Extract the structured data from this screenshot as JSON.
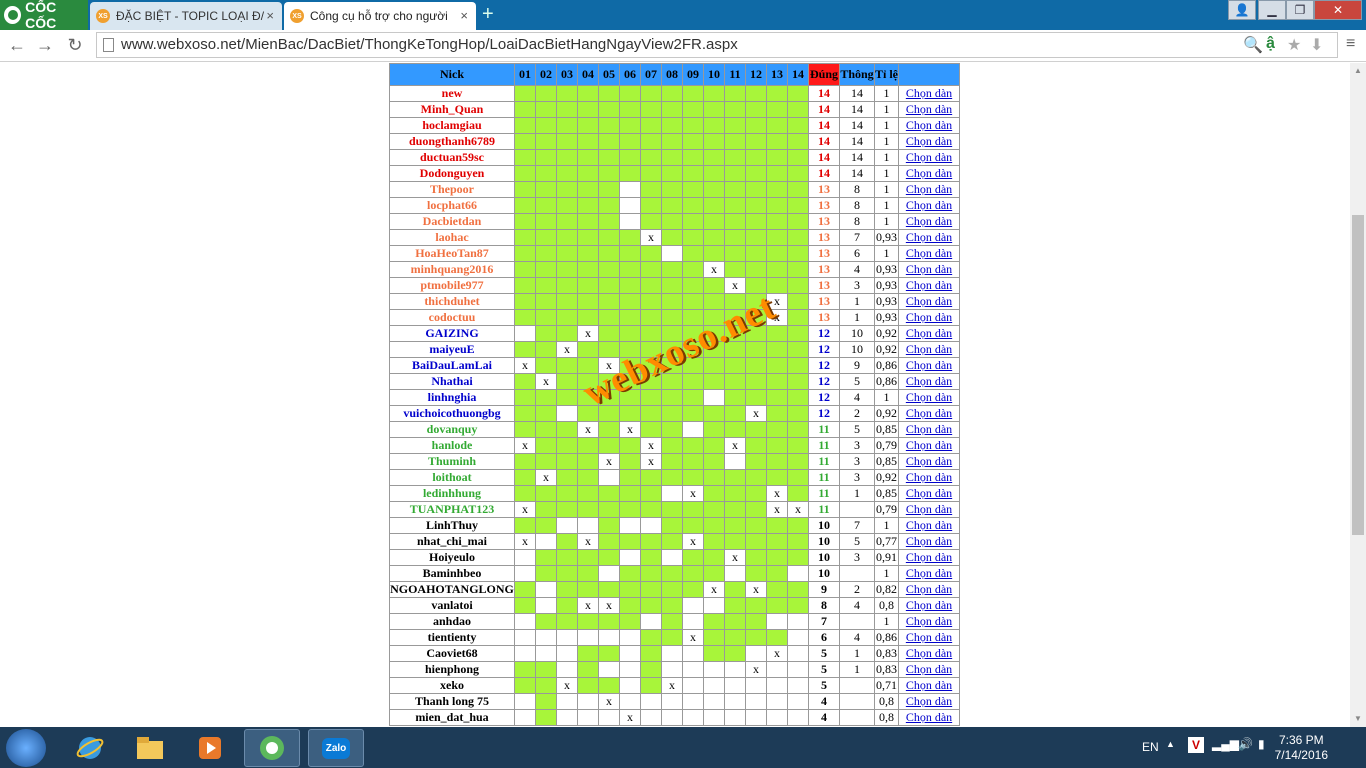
{
  "browser": {
    "brand": "CỐC CỐC",
    "tabs": [
      {
        "label": "ĐẶC BIỆT - TOPIC LOẠI Đ/",
        "favicon": "XS"
      },
      {
        "label": "Công cụ hỗ trợ cho người",
        "favicon": "XS"
      }
    ],
    "url": "www.webxoso.net/MienBac/DacBiet/ThongKeTongHop/LoaiDacBietHangNgayView2FR.aspx"
  },
  "table": {
    "headers": {
      "nick": "Nick",
      "days": [
        "01",
        "02",
        "03",
        "04",
        "05",
        "06",
        "07",
        "08",
        "09",
        "10",
        "11",
        "12",
        "13",
        "14"
      ],
      "dung": "Đúng",
      "thong": "Thông",
      "tile": "Tỉ lệ"
    },
    "link_label": "Chọn dàn",
    "rows": [
      {
        "nick": "new",
        "color": "#e00000",
        "grid": "GGGGGGGGGGGGGG",
        "dung": "14",
        "thong": "14",
        "tile": "1"
      },
      {
        "nick": "Minh_Quan",
        "color": "#e00000",
        "grid": "GGGGGGGGGGGGGG",
        "dung": "14",
        "thong": "14",
        "tile": "1"
      },
      {
        "nick": "hoclamgiau",
        "color": "#e00000",
        "grid": "GGGGGGGGGGGGGG",
        "dung": "14",
        "thong": "14",
        "tile": "1"
      },
      {
        "nick": "duongthanh6789",
        "color": "#e00000",
        "grid": "GGGGGGGGGGGGGG",
        "dung": "14",
        "thong": "14",
        "tile": "1"
      },
      {
        "nick": "ductuan59sc",
        "color": "#e00000",
        "grid": "GGGGGGGGGGGGGG",
        "dung": "14",
        "thong": "14",
        "tile": "1"
      },
      {
        "nick": "Dodonguyen",
        "color": "#e00000",
        "grid": "GGGGGGGGGGGGGG",
        "dung": "14",
        "thong": "14",
        "tile": "1"
      },
      {
        "nick": "Thepoor",
        "color": "#f07040",
        "grid": "GGGGGWGGGGGGGG",
        "dung": "13",
        "thong": "8",
        "tile": "1"
      },
      {
        "nick": "locphat66",
        "color": "#f07040",
        "grid": "GGGGGWGGGGGGGG",
        "dung": "13",
        "thong": "8",
        "tile": "1"
      },
      {
        "nick": "Dacbietdan",
        "color": "#f07040",
        "grid": "GGGGGWGGGGGGGG",
        "dung": "13",
        "thong": "8",
        "tile": "1"
      },
      {
        "nick": "laohac",
        "color": "#f07040",
        "grid": "GGGGGGXGGGGGGG",
        "dung": "13",
        "thong": "7",
        "tile": "0,93"
      },
      {
        "nick": "HoaHeoTan87",
        "color": "#f07040",
        "grid": "GGGGGGGWGGGGGG",
        "dung": "13",
        "thong": "6",
        "tile": "1"
      },
      {
        "nick": "minhquang2016",
        "color": "#f07040",
        "grid": "GGGGGGGGGXGGGG",
        "dung": "13",
        "thong": "4",
        "tile": "0,93"
      },
      {
        "nick": "ptmobile977",
        "color": "#f07040",
        "grid": "GGGGGGGGGGXGGG",
        "dung": "13",
        "thong": "3",
        "tile": "0,93"
      },
      {
        "nick": "thichduhet",
        "color": "#f07040",
        "grid": "GGGGGGGGGGGGXG",
        "dung": "13",
        "thong": "1",
        "tile": "0,93"
      },
      {
        "nick": "codoctuu",
        "color": "#f07040",
        "grid": "GGGGGGGGGGGGXG",
        "dung": "13",
        "thong": "1",
        "tile": "0,93"
      },
      {
        "nick": "GAIZING",
        "color": "#0000cc",
        "grid": "WGGXGGGGGGGGGG",
        "dung": "12",
        "thong": "10",
        "tile": "0,92"
      },
      {
        "nick": "maiyeuE",
        "color": "#0000cc",
        "grid": "GGXGGGGGGGGGGG",
        "dung": "12",
        "thong": "10",
        "tile": "0,92"
      },
      {
        "nick": "BaiDauLamLai",
        "color": "#0000cc",
        "grid": "XGGGXGGGGGGGGG",
        "dung": "12",
        "thong": "9",
        "tile": "0,86"
      },
      {
        "nick": "Nhathai",
        "color": "#0000cc",
        "grid": "GXGGGGGGGGGGGG",
        "dung": "12",
        "thong": "5",
        "tile": "0,86"
      },
      {
        "nick": "linhnghia",
        "color": "#0000cc",
        "grid": "GGGGGGGGGWGGGG",
        "dung": "12",
        "thong": "4",
        "tile": "1"
      },
      {
        "nick": "vuichoicothuongbg",
        "color": "#0000cc",
        "grid": "GGWGGGGGGGGXGG",
        "dung": "12",
        "thong": "2",
        "tile": "0,92"
      },
      {
        "nick": "dovanquy",
        "color": "#33aa33",
        "grid": "GGGXGXGGWGGGGG",
        "dung": "11",
        "thong": "5",
        "tile": "0,85"
      },
      {
        "nick": "hanlode",
        "color": "#33aa33",
        "grid": "XGGGGGXGGGXGGG",
        "dung": "11",
        "thong": "3",
        "tile": "0,79"
      },
      {
        "nick": "Thuminh",
        "color": "#33aa33",
        "grid": "GGGGXGXGGGWGGG",
        "dung": "11",
        "thong": "3",
        "tile": "0,85"
      },
      {
        "nick": "loithoat",
        "color": "#33aa33",
        "grid": "GXGGWGGGGGGGGG",
        "dung": "11",
        "thong": "3",
        "tile": "0,92"
      },
      {
        "nick": "ledinhhung",
        "color": "#33aa33",
        "grid": "GGGGGGGWXGGGXG",
        "dung": "11",
        "thong": "1",
        "tile": "0,85"
      },
      {
        "nick": "TUANPHAT123",
        "color": "#33aa33",
        "grid": "XGGGGGGGGGGGXX",
        "dung": "11",
        "thong": "",
        "tile": "0,79"
      },
      {
        "nick": "LinhThuy",
        "color": "#000000",
        "grid": "GGWWGWWGGGGGGG",
        "dung": "10",
        "thong": "7",
        "tile": "1"
      },
      {
        "nick": "nhat_chi_mai",
        "color": "#000000",
        "grid": "XWGXGGGGXGGGGG",
        "dung": "10",
        "thong": "5",
        "tile": "0,77"
      },
      {
        "nick": "Hoiyeulo",
        "color": "#000000",
        "grid": "WGGGGWGWGGXGGG",
        "dung": "10",
        "thong": "3",
        "tile": "0,91"
      },
      {
        "nick": "Baminhbeo",
        "color": "#000000",
        "grid": "WGGGWGGGGGWGGW",
        "dung": "10",
        "thong": "",
        "tile": "1"
      },
      {
        "nick": "NGOAHOTANGLONG",
        "color": "#000000",
        "grid": "GWGGGGGGGXGXGG",
        "dung": "9",
        "thong": "2",
        "tile": "0,82"
      },
      {
        "nick": "vanlatoi",
        "color": "#000000",
        "grid": "GWGXXGGGWWGGGG",
        "dung": "8",
        "thong": "4",
        "tile": "0,8"
      },
      {
        "nick": "anhdao",
        "color": "#000000",
        "grid": "WGGGGGWGWGGGWW",
        "dung": "7",
        "thong": "",
        "tile": "1"
      },
      {
        "nick": "tientienty",
        "color": "#000000",
        "grid": "WWWWWWGGXGGGGW",
        "dung": "6",
        "thong": "4",
        "tile": "0,86"
      },
      {
        "nick": "Caoviet68",
        "color": "#000000",
        "grid": "WWWGGWGWWGGWXW",
        "dung": "5",
        "thong": "1",
        "tile": "0,83"
      },
      {
        "nick": "hienphong",
        "color": "#000000",
        "grid": "GGWGWWGWWWWXWW",
        "dung": "5",
        "thong": "1",
        "tile": "0,83"
      },
      {
        "nick": "xeko",
        "color": "#000000",
        "grid": "GGXGGWGXWWWWWW",
        "dung": "5",
        "thong": "",
        "tile": "0,71"
      },
      {
        "nick": "Thanh long 75",
        "color": "#000000",
        "grid": "WGWWXWWWWWWWWW",
        "dung": "4",
        "thong": "",
        "tile": "0,8"
      },
      {
        "nick": "mien_dat_hua",
        "color": "#000000",
        "grid": "WGWWWXWWWWWWWW",
        "dung": "4",
        "thong": "",
        "tile": "0,8"
      }
    ]
  },
  "watermark": "webxoso.net",
  "taskbar": {
    "apps": [
      "Internet Explorer",
      "File Explorer",
      "Media Player",
      "Cốc Cốc",
      "Zalo"
    ],
    "zalo_label": "Zalo",
    "lang": "EN",
    "time": "7:36 PM",
    "date": "7/14/2016"
  },
  "colors": {
    "green_cell": "#a8f53a",
    "header_blue": "#3399ff",
    "dung_red": "#ff1a1a",
    "taskbar": "#1d3b57"
  }
}
